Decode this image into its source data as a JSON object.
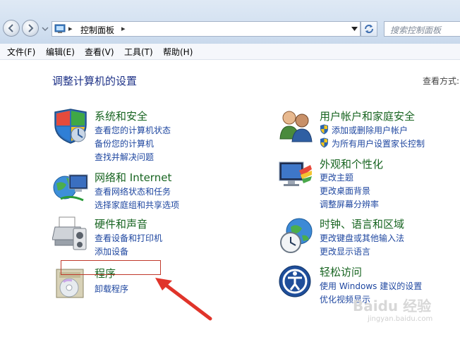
{
  "address": {
    "path": "控制面板",
    "arrow": "▸"
  },
  "search": {
    "placeholder": "搜索控制面板"
  },
  "menu": [
    "文件(F)",
    "编辑(E)",
    "查看(V)",
    "工具(T)",
    "帮助(H)"
  ],
  "heading": "调整计算机的设置",
  "view_by": "查看方式:",
  "categories": {
    "system_security": {
      "title": "系统和安全",
      "links": [
        "查看您的计算机状态",
        "备份您的计算机",
        "查找并解决问题"
      ]
    },
    "network": {
      "title": "网络和 Internet",
      "links": [
        "查看网络状态和任务",
        "选择家庭组和共享选项"
      ]
    },
    "hardware": {
      "title": "硬件和声音",
      "links": [
        "查看设备和打印机",
        "添加设备"
      ]
    },
    "programs": {
      "title": "程序",
      "links": [
        "卸载程序"
      ]
    },
    "user_accounts": {
      "title": "用户帐户和家庭安全",
      "links": [
        "添加或删除用户帐户",
        "为所有用户设置家长控制"
      ]
    },
    "appearance": {
      "title": "外观和个性化",
      "links": [
        "更改主题",
        "更改桌面背景",
        "调整屏幕分辨率"
      ]
    },
    "clock": {
      "title": "时钟、语言和区域",
      "links": [
        "更改键盘或其他输入法",
        "更改显示语言"
      ]
    },
    "ease": {
      "title": "轻松访问",
      "links": [
        "使用 Windows 建议的设置",
        "优化视频显示"
      ]
    }
  },
  "watermark": {
    "brand": "Baidu 经验",
    "url": "jingyan.baidu.com"
  },
  "colors": {
    "title_green": "#176420",
    "link_blue": "#1f47a0",
    "heading_blue": "#1e3287",
    "annotation_red": "#c0392b"
  }
}
